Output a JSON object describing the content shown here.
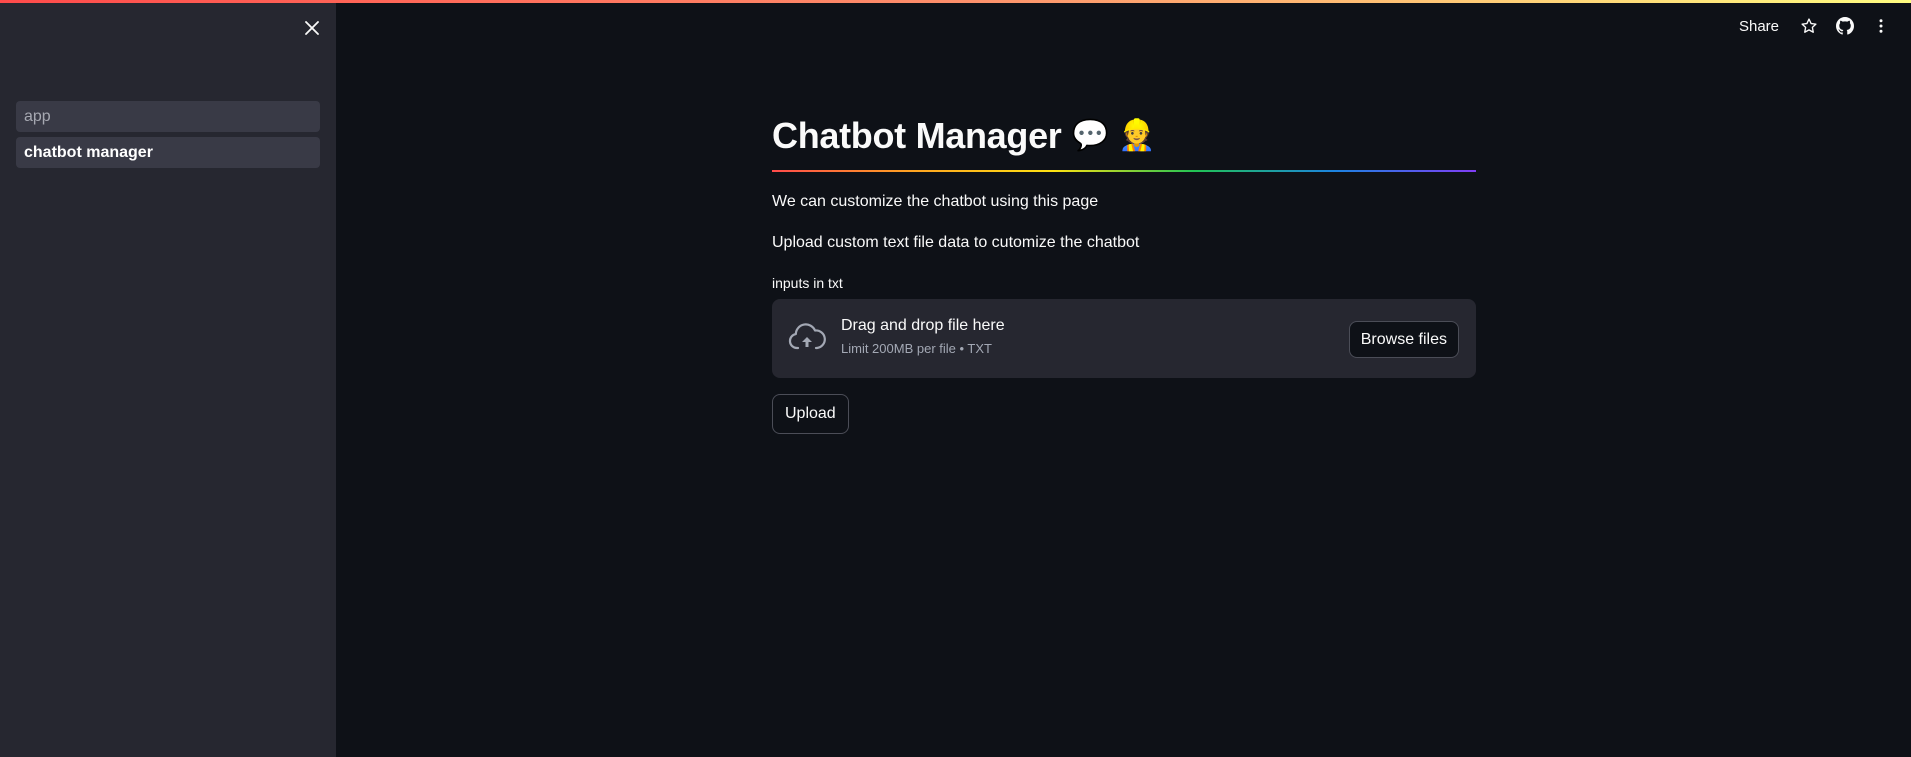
{
  "sidebar": {
    "items": [
      {
        "label": "app"
      },
      {
        "label": "chatbot manager"
      }
    ]
  },
  "toolbar": {
    "share_label": "Share",
    "icons": [
      "star-icon",
      "github-icon",
      "more-vertical-icon"
    ]
  },
  "main": {
    "title": "Chatbot Manager",
    "title_emojis": "💬 👷",
    "intro_text": "We can customize the chatbot using this page",
    "upload_text": "Upload custom text file data to cutomize the chatbot",
    "uploader": {
      "label": "inputs in txt",
      "drop_title": "Drag and drop file here",
      "drop_subtitle": "Limit 200MB per file • TXT",
      "browse_label": "Browse files"
    },
    "upload_button_label": "Upload"
  },
  "colors": {
    "background": "#0e1117",
    "sidebar": "#262730",
    "accent": "#ff4b4b"
  }
}
